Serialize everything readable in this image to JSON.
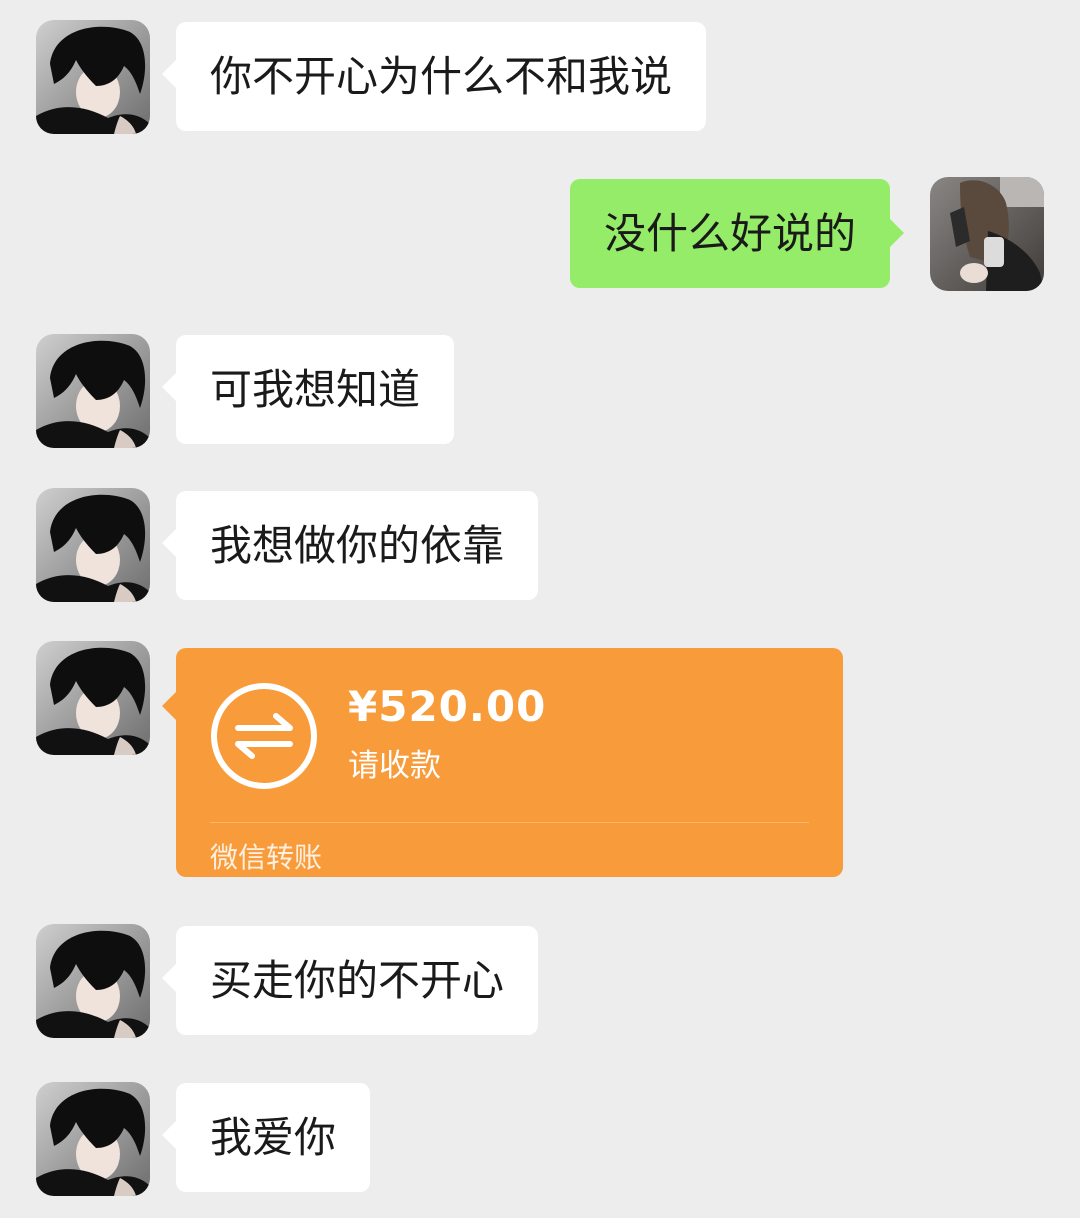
{
  "messages": [
    {
      "sender": "other",
      "text": "你不开心为什么不和我说"
    },
    {
      "sender": "me",
      "text": "没什么好说的"
    },
    {
      "sender": "other",
      "text": "可我想知道"
    },
    {
      "sender": "other",
      "text": "我想做你的依靠"
    },
    {
      "sender": "other",
      "type": "transfer",
      "amount": "¥520.00",
      "note": "请收款",
      "footer": "微信转账"
    },
    {
      "sender": "other",
      "text": "买走你的不开心"
    },
    {
      "sender": "other",
      "text": "我爱你"
    }
  ],
  "icons": {
    "transfer": "transfer-arrows-icon"
  },
  "colors": {
    "background": "#ededed",
    "incoming_bubble": "#ffffff",
    "outgoing_bubble": "#95ec69",
    "transfer_card": "#f89c3b"
  }
}
